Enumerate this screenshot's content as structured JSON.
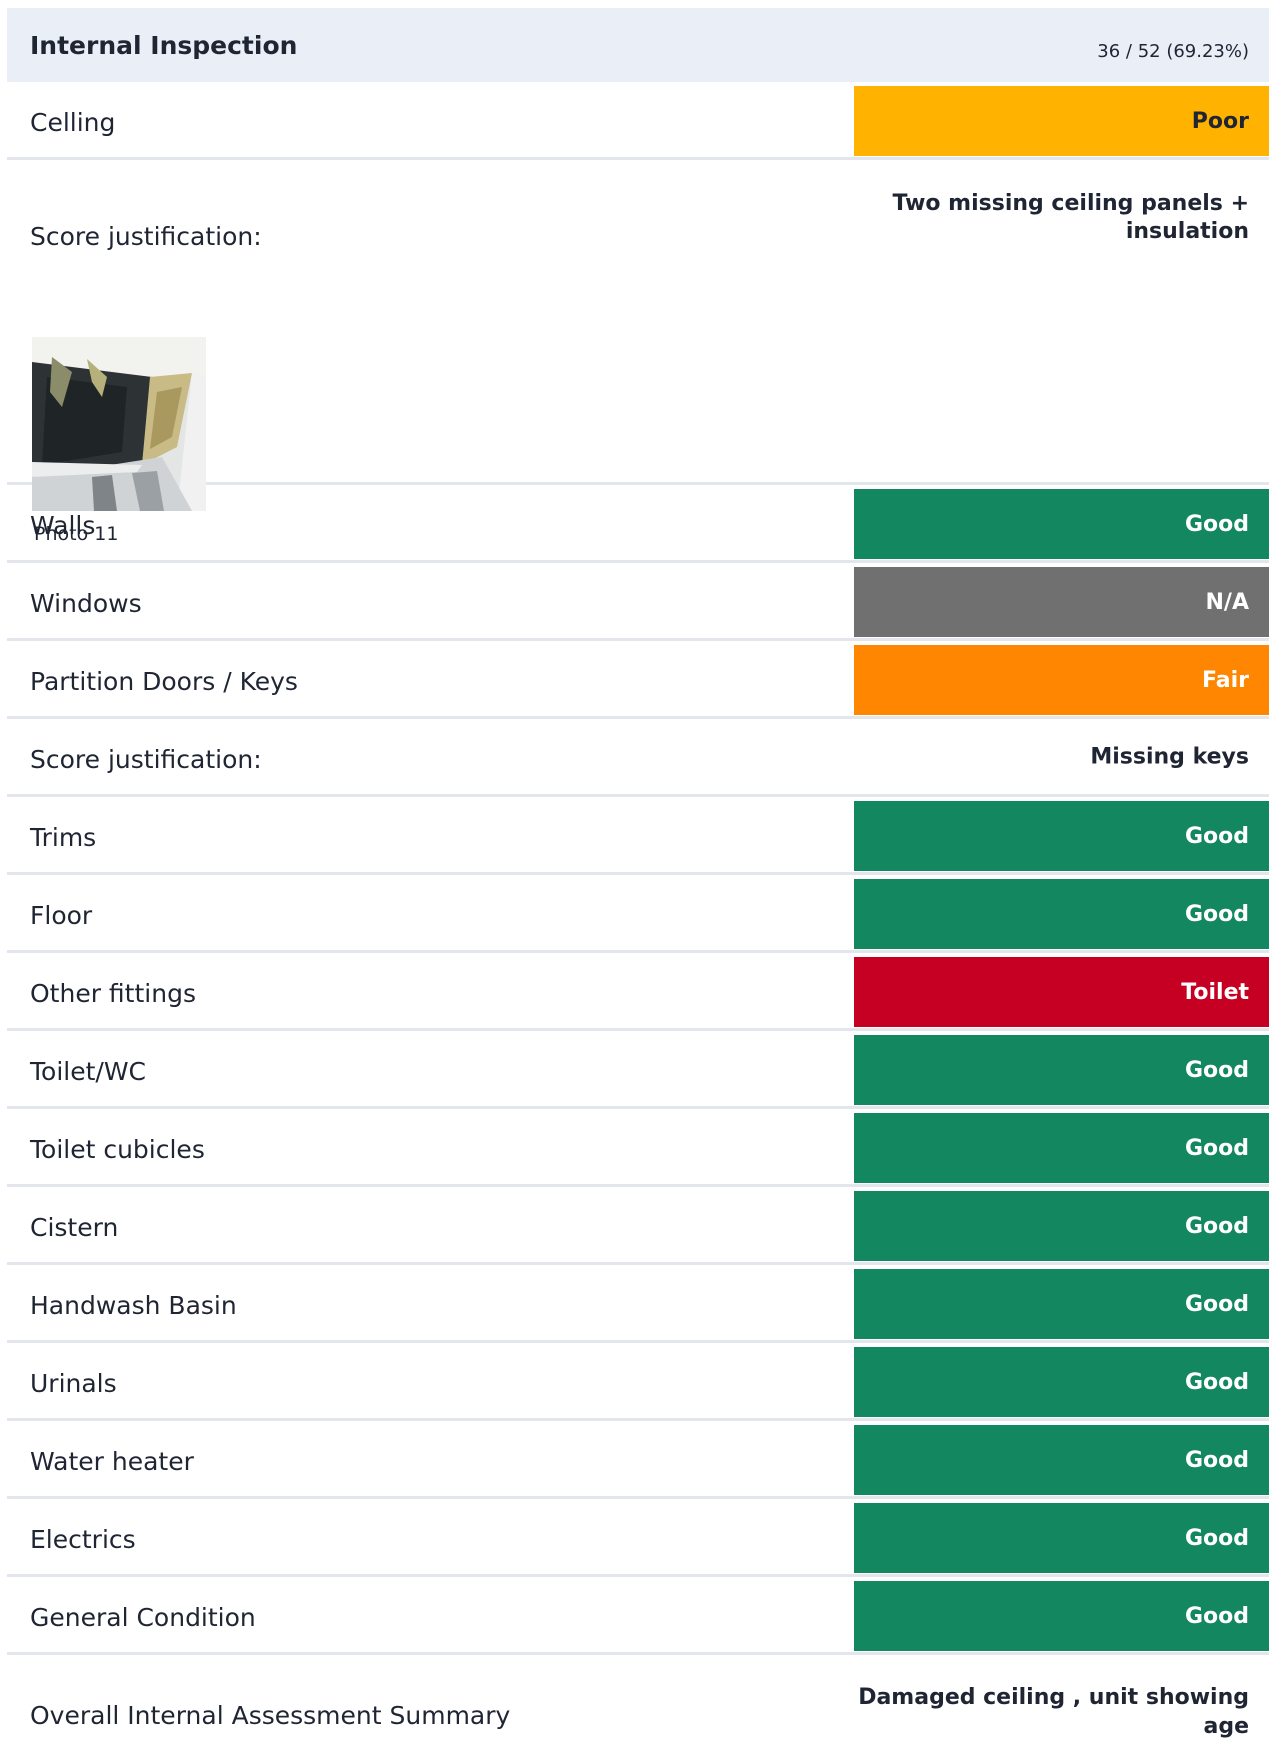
{
  "header": {
    "title": "Internal Inspection",
    "score": "36 / 52 (69.23%)"
  },
  "colors": {
    "poor": "#ffb300",
    "good": "#138760",
    "na": "#707070",
    "fair": "#ff8600",
    "fail": "#c60022",
    "header_bg": "#e9eef7"
  },
  "items": [
    {
      "label": "Celling",
      "rating": "Poor",
      "color": "#ffb300",
      "text_color": "#1f2533"
    },
    {
      "label": "Score justification:",
      "note": "Two missing ceiling panels + insulation",
      "photo_caption": "Photo 11"
    },
    {
      "label": "Walls",
      "rating": "Good",
      "color": "#138760"
    },
    {
      "label": "Windows",
      "rating": "N/A",
      "color": "#707070"
    },
    {
      "label": "Partition Doors / Keys",
      "rating": "Fair",
      "color": "#ff8600"
    },
    {
      "label": "Score justification:",
      "note": "Missing keys"
    },
    {
      "label": "Trims",
      "rating": "Good",
      "color": "#138760"
    },
    {
      "label": "Floor",
      "rating": "Good",
      "color": "#138760"
    },
    {
      "label": "Other fittings",
      "rating": "Toilet",
      "color": "#c60022"
    },
    {
      "label": "Toilet/WC",
      "rating": "Good",
      "color": "#138760"
    },
    {
      "label": "Toilet cubicles",
      "rating": "Good",
      "color": "#138760"
    },
    {
      "label": "Cistern",
      "rating": "Good",
      "color": "#138760"
    },
    {
      "label": "Handwash Basin",
      "rating": "Good",
      "color": "#138760"
    },
    {
      "label": "Urinals",
      "rating": "Good",
      "color": "#138760"
    },
    {
      "label": "Water heater",
      "rating": "Good",
      "color": "#138760"
    },
    {
      "label": "Electrics",
      "rating": "Good",
      "color": "#138760"
    },
    {
      "label": "General Condition",
      "rating": "Good",
      "color": "#138760"
    },
    {
      "label": "Overall Internal Assessment Summary",
      "note": "Damaged ceiling , unit showing age"
    }
  ]
}
